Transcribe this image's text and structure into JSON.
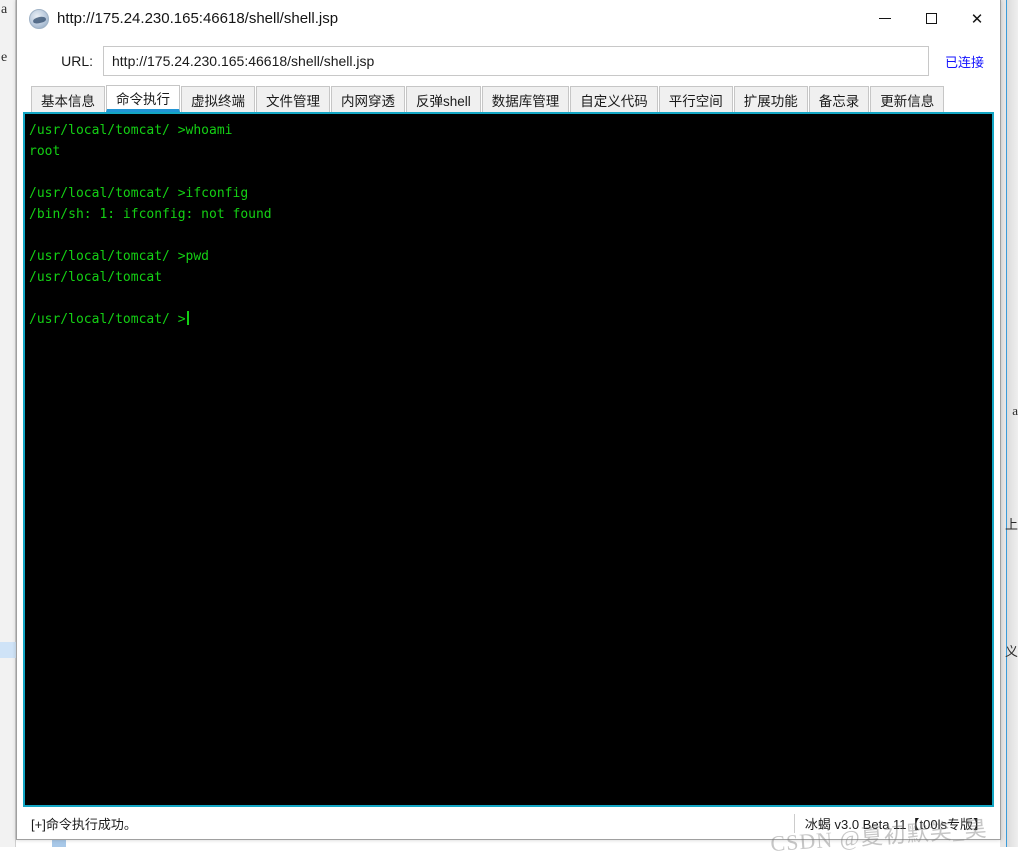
{
  "window": {
    "title": "http://175.24.230.165:46618/shell/shell.jsp",
    "icon": "scorpion-logo-icon",
    "minimize_label": "—",
    "maximize_label": "□",
    "close_label": "✕"
  },
  "url_bar": {
    "label": "URL:",
    "value": "http://175.24.230.165:46618/shell/shell.jsp",
    "placeholder": "http://",
    "connection_status": "已连接",
    "connection_status_color": "#1414ff"
  },
  "tabs": [
    {
      "label": "基本信息",
      "active": false
    },
    {
      "label": "命令执行",
      "active": true
    },
    {
      "label": "虚拟终端",
      "active": false
    },
    {
      "label": "文件管理",
      "active": false
    },
    {
      "label": "内网穿透",
      "active": false
    },
    {
      "label": "反弹shell",
      "active": false
    },
    {
      "label": "数据库管理",
      "active": false
    },
    {
      "label": "自定义代码",
      "active": false
    },
    {
      "label": "平行空间",
      "active": false
    },
    {
      "label": "扩展功能",
      "active": false
    },
    {
      "label": "备忘录",
      "active": false
    },
    {
      "label": "更新信息",
      "active": false
    }
  ],
  "terminal": {
    "background_color": "#000000",
    "text_color": "#14d014",
    "border_color": "#13a6c4",
    "lines": [
      "/usr/local/tomcat/ >whoami",
      "root",
      "",
      "/usr/local/tomcat/ >ifconfig",
      "/bin/sh: 1: ifconfig: not found",
      "",
      "/usr/local/tomcat/ >pwd",
      "/usr/local/tomcat",
      "",
      "/usr/local/tomcat/ >"
    ],
    "cursor_visible": true
  },
  "status_bar": {
    "message": "[+]命令执行成功。",
    "app_version": "冰蝎 v3.0 Beta 11【t00ls专版】"
  },
  "watermark": {
    "text": "CSDN @夏初默笑_昊"
  },
  "background": {
    "left_glyphs": [
      "a",
      "e"
    ],
    "right_glyphs": [
      "a",
      "上",
      "义"
    ]
  }
}
